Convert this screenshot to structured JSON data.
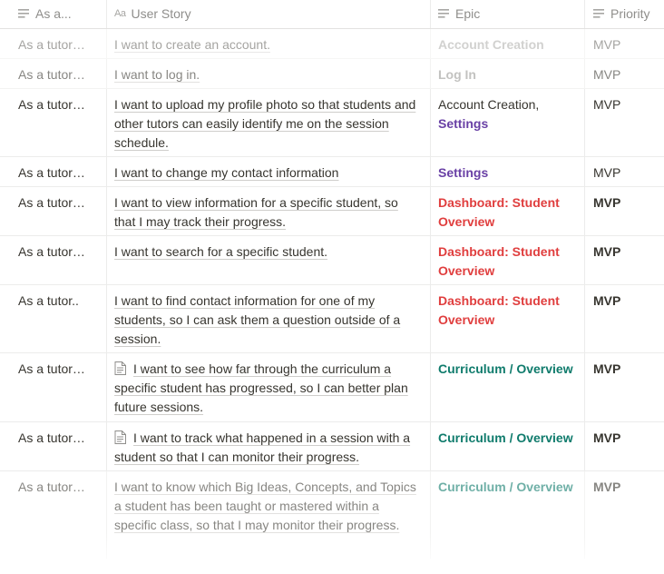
{
  "columns": [
    {
      "label": "As a...",
      "icon": "text-lines-icon"
    },
    {
      "label": "User Story",
      "icon": "aa-text-icon",
      "icon_text": "Aa"
    },
    {
      "label": "Epic",
      "icon": "text-lines-icon"
    },
    {
      "label": "Priority",
      "icon": "text-lines-icon"
    }
  ],
  "rows": [
    {
      "as": "As a tutor…",
      "story": "I want to create an account.",
      "epic": "Account Creation",
      "epic_tail": "",
      "priority": "MVP"
    },
    {
      "as": "As a tutor…",
      "story": "I want to log in.",
      "epic": "Log In",
      "epic_tail": "",
      "priority": "MVP"
    },
    {
      "as": "As a tutor…",
      "story": "I want to upload my profile photo so that students and other tutors can easily identify me on the session schedule.",
      "epic": "Account Creation,",
      "epic_tail": "Settings",
      "priority": "MVP"
    },
    {
      "as": "As a tutor…",
      "story": "I want to change my contact information",
      "epic": "Settings",
      "epic_tail": "",
      "priority": "MVP"
    },
    {
      "as": "As a tutor…",
      "story": "I want to view information for a specific student, so that I may track their progress.",
      "epic": "Dashboard: Student Overview",
      "epic_tail": "",
      "priority": "MVP"
    },
    {
      "as": "As a tutor…",
      "story": "I want to search for a specific student.",
      "epic": "Dashboard: Student Overview",
      "epic_tail": "",
      "priority": "MVP"
    },
    {
      "as": "As a tutor..",
      "story": "I want to find contact information for one of my students, so I can ask them a question outside of a session.",
      "epic": "Dashboard: Student Overview",
      "epic_tail": "",
      "priority": "MVP"
    },
    {
      "as": "As a tutor…",
      "story": "I want to see how far through the curriculum a specific student has progressed, so I can better plan future sessions.",
      "epic": "Curriculum / Overview",
      "epic_tail": "",
      "priority": "MVP",
      "has_doc_icon": true
    },
    {
      "as": "As a tutor…",
      "story": "I want to track what happened in a session with a student so that I can monitor their progress.",
      "epic": "Curriculum / Overview",
      "epic_tail": "",
      "priority": "MVP",
      "has_doc_icon": true
    },
    {
      "as": "As a tutor…",
      "story": "I want to know which Big Ideas, Concepts, and Topics a student has been taught or mastered within a specific class, so that I may monitor their progress.",
      "epic": "Curriculum / Overview",
      "epic_tail": "",
      "priority": "MVP"
    }
  ],
  "colors": {
    "purple": "#6940a5",
    "red": "#e03e3e",
    "green": "#0f7b6c",
    "text": "#37352f",
    "muted": "#9b9a97"
  }
}
